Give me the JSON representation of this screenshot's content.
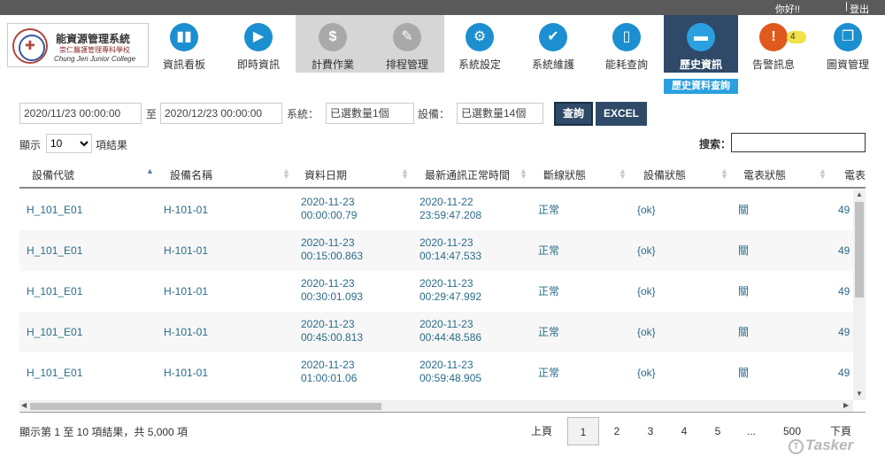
{
  "topbar": {
    "greeting": "你好!!",
    "separator": "|",
    "logout": "登出"
  },
  "logo": {
    "title": "能資源管理系統",
    "subtitle": "崇仁醫護管理專科學校",
    "english": "Chung Jen Junior College"
  },
  "nav": [
    {
      "label": "資訊看板",
      "icon": "bar-chart-icon",
      "glyph": "▮▮"
    },
    {
      "label": "即時資訊",
      "icon": "realtime-icon",
      "glyph": "▶"
    },
    {
      "label": "計費作業",
      "icon": "dollar-icon",
      "glyph": "$"
    },
    {
      "label": "排程管理",
      "icon": "schedule-icon",
      "glyph": "✎"
    },
    {
      "label": "系統設定",
      "icon": "gear-icon",
      "glyph": "⚙"
    },
    {
      "label": "系統維護",
      "icon": "wrench-icon",
      "glyph": "✔"
    },
    {
      "label": "能耗查詢",
      "icon": "battery-icon",
      "glyph": "▯"
    },
    {
      "label": "歷史資訊",
      "icon": "folder-icon",
      "glyph": "▬"
    },
    {
      "label": "告警訊息",
      "icon": "alert-icon",
      "glyph": "!",
      "badge": "4"
    },
    {
      "label": "圖資管理",
      "icon": "layers-icon",
      "glyph": "❐"
    }
  ],
  "subtab": "歷史資料查詢",
  "filters": {
    "start": "2020/11/23 00:00:00",
    "to": "至",
    "end": "2020/12/23 00:00:00",
    "system_label": "系統：",
    "system_value": "已選數量1個",
    "device_label": "設備：",
    "device_value": "已選數量14個",
    "query_button": "查詢",
    "excel_button": "EXCEL"
  },
  "entries": {
    "show": "顯示",
    "value": "10",
    "suffix": "項結果",
    "options": [
      "10"
    ]
  },
  "search": {
    "label": "搜索：",
    "value": ""
  },
  "table": {
    "headers": [
      "設備代號",
      "設備名稱",
      "資料日期",
      "最新通訊正常時間",
      "斷線狀態",
      "設備狀態",
      "電表狀態",
      "電表"
    ],
    "rows": [
      {
        "code": "H_101_E01",
        "name": "H-101-01",
        "date1": "2020-11-23",
        "date2": "00:00:00.79",
        "comm1": "2020-11-22",
        "comm2": "23:59:47.208",
        "line": "正常",
        "device": "{ok}",
        "meter": "關",
        "extra": "49"
      },
      {
        "code": "H_101_E01",
        "name": "H-101-01",
        "date1": "2020-11-23",
        "date2": "00:15:00.863",
        "comm1": "2020-11-23",
        "comm2": "00:14:47.533",
        "line": "正常",
        "device": "{ok}",
        "meter": "關",
        "extra": "49"
      },
      {
        "code": "H_101_E01",
        "name": "H-101-01",
        "date1": "2020-11-23",
        "date2": "00:30:01.093",
        "comm1": "2020-11-23",
        "comm2": "00:29:47.992",
        "line": "正常",
        "device": "{ok}",
        "meter": "關",
        "extra": "49"
      },
      {
        "code": "H_101_E01",
        "name": "H-101-01",
        "date1": "2020-11-23",
        "date2": "00:45:00.813",
        "comm1": "2020-11-23",
        "comm2": "00:44:48.586",
        "line": "正常",
        "device": "{ok}",
        "meter": "關",
        "extra": "49"
      },
      {
        "code": "H_101_E01",
        "name": "H-101-01",
        "date1": "2020-11-23",
        "date2": "01:00:01.06",
        "comm1": "2020-11-23",
        "comm2": "00:59:48.905",
        "line": "正常",
        "device": "{ok}",
        "meter": "關",
        "extra": "49"
      }
    ]
  },
  "footer": {
    "info": "顯示第 1 至 10 項結果，共 5,000 項",
    "prev": "上頁",
    "pages": [
      "1",
      "2",
      "3",
      "4",
      "5",
      "...",
      "500"
    ],
    "next": "下頁",
    "watermark": "Tasker"
  }
}
